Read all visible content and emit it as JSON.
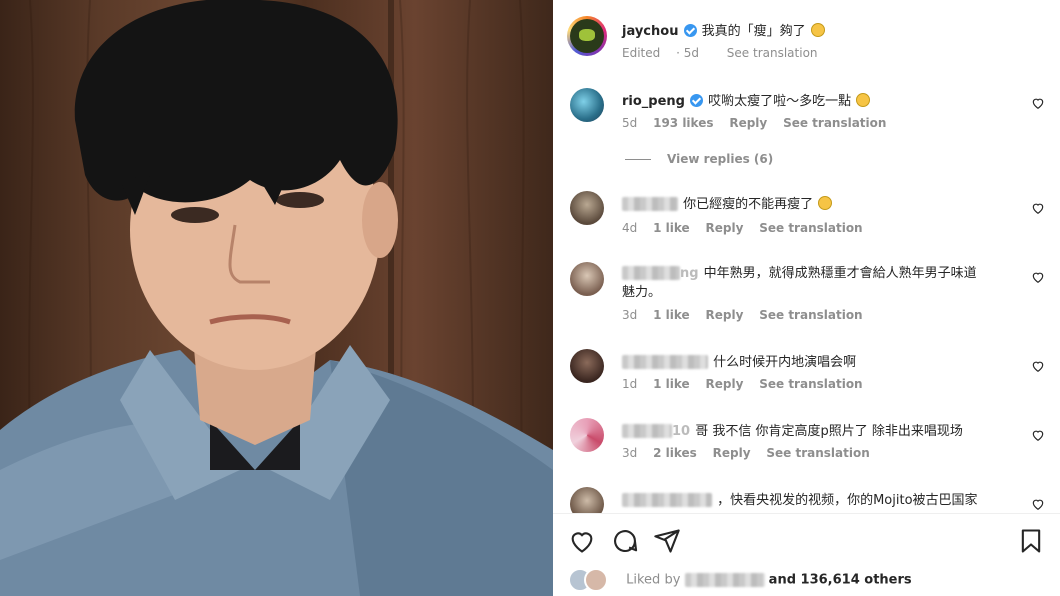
{
  "post": {
    "author": "jaychou",
    "caption": "我真的「瘦」夠了",
    "edited_label": "Edited",
    "age": "5d",
    "see_translation": "See translation"
  },
  "comments": [
    {
      "username": "rio_peng",
      "text": "哎喲太瘦了啦～多吃一點",
      "age": "5d",
      "likes": "193 likes",
      "reply": "Reply",
      "see_translation": "See translation",
      "view_replies": "View replies (6)"
    },
    {
      "username_visible": "",
      "text": "你已經瘦的不能再瘦了",
      "age": "4d",
      "likes": "1 like",
      "reply": "Reply",
      "see_translation": "See translation"
    },
    {
      "username_visible": "ng",
      "text_line1": "中年熟男，就得成熟穩重才會給人熟年男子味道",
      "text_line2": "魅力。",
      "age": "3d",
      "likes": "1 like",
      "reply": "Reply",
      "see_translation": "See translation"
    },
    {
      "username_visible": "",
      "text": "什么时候开内地演唱会啊",
      "age": "1d",
      "likes": "1 like",
      "reply": "Reply",
      "see_translation": "See translation"
    },
    {
      "username_visible": "10",
      "text": "哥 我不信 你肯定高度p照片了 除非出来唱现场",
      "age": "3d",
      "likes": "2 likes",
      "reply": "Reply",
      "see_translation": "See translation"
    },
    {
      "username_visible": "",
      "text": "，快看央视发的视频，你的Mojito被古巴国家"
    }
  ],
  "liked_by": {
    "prefix": "Liked by",
    "suffix": "and 136,614 others"
  },
  "colors": {
    "verified": "#3897f0",
    "meta_gray": "#8e8e8e",
    "text": "#262626"
  },
  "icons": [
    "heart-icon",
    "comment-icon",
    "share-icon",
    "bookmark-icon",
    "verified-badge-icon"
  ]
}
